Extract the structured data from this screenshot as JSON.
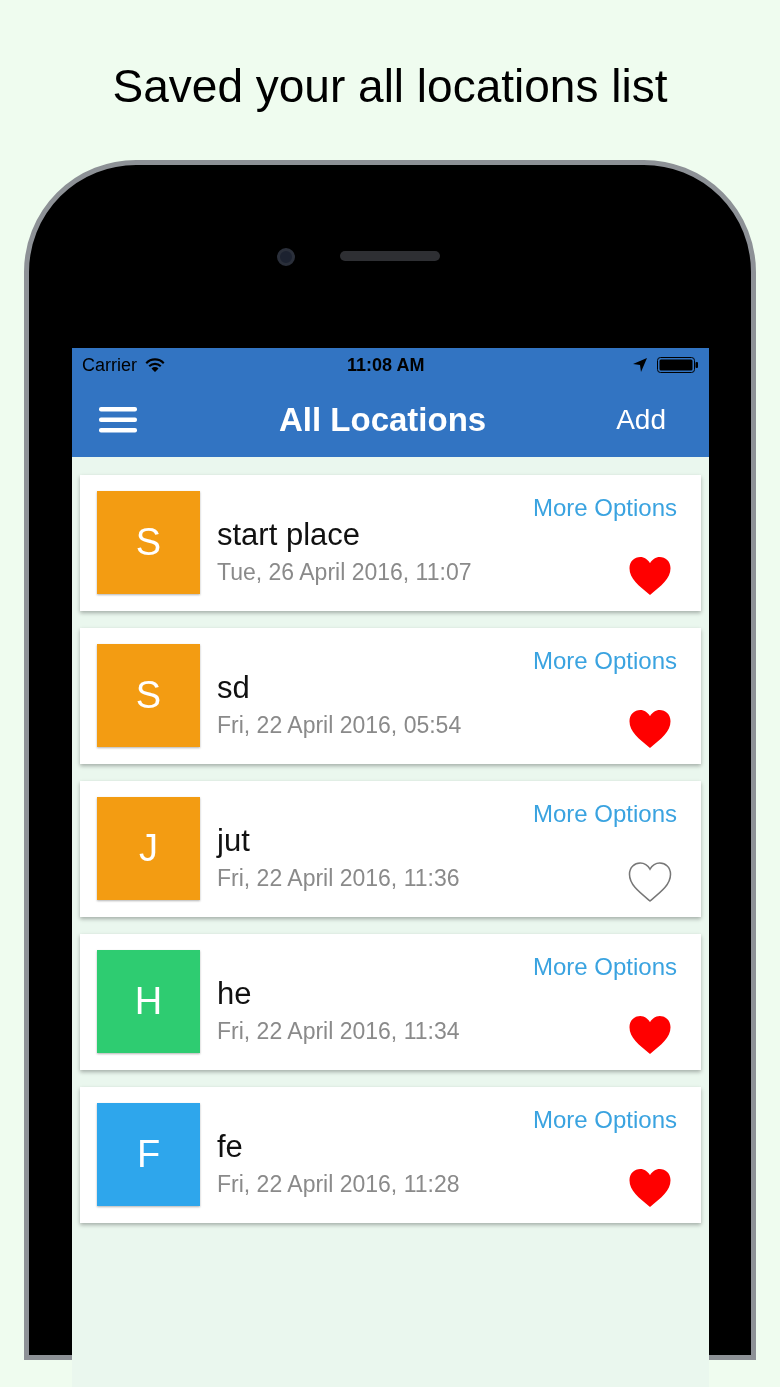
{
  "headline": "Saved your all locations list",
  "status_bar": {
    "carrier": "Carrier",
    "time": "11:08 AM"
  },
  "nav": {
    "title": "All Locations",
    "add_button": "Add"
  },
  "locations": [
    {
      "initial": "S",
      "color": "#f39c12",
      "name": "start place",
      "date": "Tue, 26 April 2016, 11:07",
      "action": "More Options",
      "favorite": true
    },
    {
      "initial": "S",
      "color": "#f39c12",
      "name": "sd",
      "date": "Fri, 22 April 2016, 05:54",
      "action": "More Options",
      "favorite": true
    },
    {
      "initial": "J",
      "color": "#f39c12",
      "name": "jut",
      "date": "Fri, 22 April 2016, 11:36",
      "action": "More Options",
      "favorite": false
    },
    {
      "initial": "H",
      "color": "#2ecc71",
      "name": "he",
      "date": "Fri, 22 April 2016, 11:34",
      "action": "More Options",
      "favorite": true
    },
    {
      "initial": "F",
      "color": "#2ea6ec",
      "name": "fe",
      "date": "Fri, 22 April 2016, 11:28",
      "action": "More Options",
      "favorite": true
    }
  ]
}
